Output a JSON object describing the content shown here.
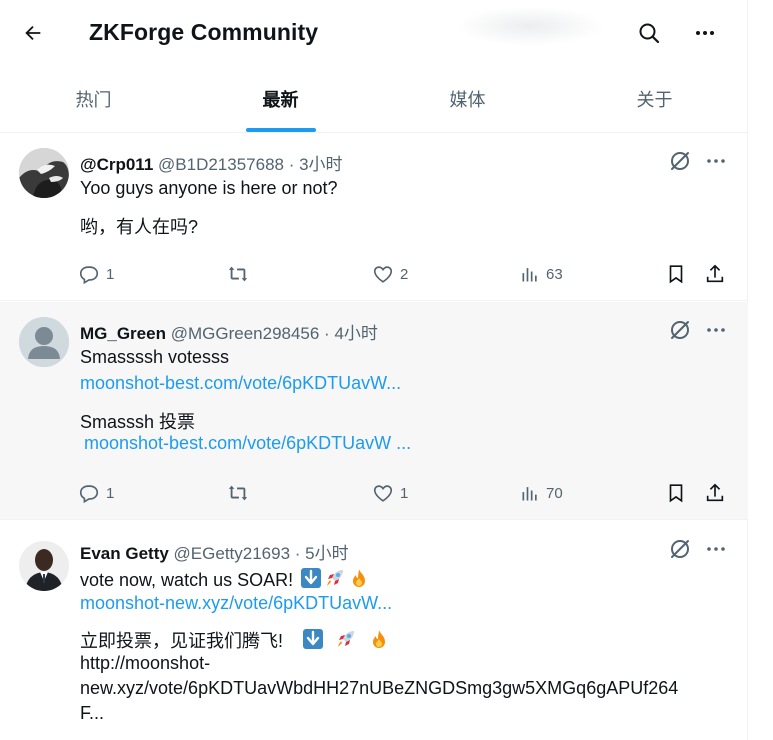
{
  "header": {
    "title": "ZKForge Community"
  },
  "tabs": [
    {
      "label": "热门",
      "active": false
    },
    {
      "label": "最新",
      "active": true
    },
    {
      "label": "媒体",
      "active": false
    },
    {
      "label": "关于",
      "active": false
    }
  ],
  "posts": [
    {
      "name": "@Crp011",
      "handle": "@B1D21357688 · 3小时",
      "text1": "Yoo guys anyone is here or not?",
      "text2": "哟，有人在吗?",
      "replies": "1",
      "likes": "2",
      "views": "63"
    },
    {
      "name": "MG_Green",
      "handle": "@MGGreen298456 · 4小时",
      "text1": "Smassssh votesss",
      "link1": "moonshot-best.com/vote/6pKDTUavW...",
      "text2": "Smasssh 投票",
      "link2": "moonshot-best.com/vote/6pKDTUavW  ...",
      "replies": "1",
      "likes": "1",
      "views": "70"
    },
    {
      "name": "Evan Getty",
      "handle": "@EGetty21693 · 5小时",
      "text1": "vote now, watch us SOAR!",
      "link1": "moonshot-new.xyz/vote/6pKDTUavW...",
      "text2": "立即投票，见证我们腾飞!",
      "text3": "http://moonshot-",
      "text4": "new.xyz/vote/6pKDTUavWbdHH27nUBeZNGDSmg3gw5XMGq6gAPUf264",
      "text5": "F..."
    }
  ],
  "icons": {
    "back": "arrow-left-icon",
    "search": "search-icon",
    "more": "more-icon",
    "reply": "reply-icon",
    "repost": "repost-icon",
    "like": "heart-icon",
    "views": "views-icon",
    "bookmark": "bookmark-icon",
    "share": "share-icon"
  },
  "colors": {
    "accent": "#1d9bf0",
    "secondary_text": "#536471",
    "highlight_row": "#f7f7f7"
  }
}
